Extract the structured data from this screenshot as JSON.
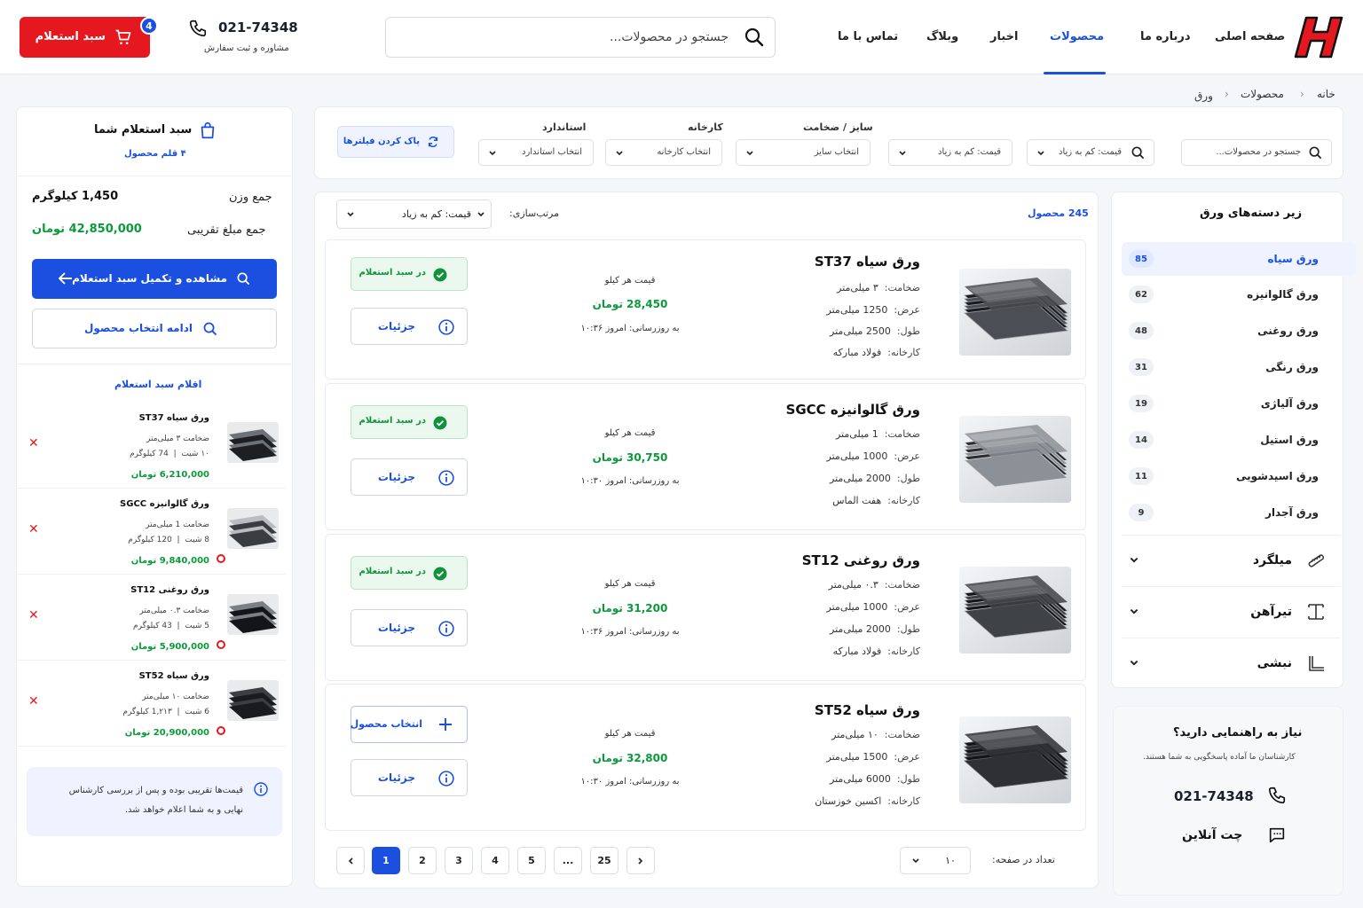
{
  "header": {
    "nav": [
      "صفحه اصلی",
      "درباره ما",
      "محصولات",
      "اخبار",
      "وبلاگ",
      "تماس با ما"
    ],
    "active_nav": "محصولات",
    "search_placeholder": "جستجو در محصولات...",
    "phone": "021-74348",
    "phone_caption": "مشاوره و ثبت سفارش",
    "cart_label": "سبد استعلام",
    "cart_count": "4"
  },
  "breadcrumb": [
    "خانه",
    "محصولات",
    "ورق"
  ],
  "filters": {
    "search_placeholder": "جستجو در محصولات...",
    "price_sort_1": "قیمت: کم به زیاد",
    "price_sort_2": "قیمت: کم به زیاد",
    "size_label": "سایز / ضخامت",
    "size_value": "انتخاب سایز",
    "factory_label": "کارخانه",
    "factory_value": "انتخاب کارخانه",
    "standard_label": "استاندارد",
    "standard_value": "انتخاب استاندارد",
    "clear_label": "پاک کردن فیلترها"
  },
  "listing": {
    "count": "245 محصول",
    "sort_label": "مرتب‌سازی:",
    "sort_value": "قیمت: کم به زیاد",
    "spec_keys": {
      "thickness": "ضخامت:",
      "width": "عرض:",
      "length": "طول:",
      "factory": "کارخانه:"
    },
    "price_label": "قیمت هر کیلو",
    "update_prefix": "به روزرسانی:",
    "in_cart_label": "در سبد استعلام",
    "details_label": "جزئیات",
    "select_label": "انتخاب محصول",
    "products": [
      {
        "title": "ورق سیاه ST37",
        "thickness": "۳ میلی‌متر",
        "width": "1250 میلی‌متر",
        "length": "2500 میلی‌متر",
        "factory": "فولاد مبارکه",
        "price": "28,450 تومان",
        "updated": "امروز ۱۰:۳۶",
        "in_cart": true
      },
      {
        "title": "ورق گالوانیزه SGCC",
        "thickness": "1 میلی‌متر",
        "width": "1000 میلی‌متر",
        "length": "2000 میلی‌متر",
        "factory": "هفت الماس",
        "price": "30,750 تومان",
        "updated": "امروز ۱۰:۳۰",
        "in_cart": true
      },
      {
        "title": "ورق روغنی ST12",
        "thickness": "۰.۳ میلی‌متر",
        "width": "1000 میلی‌متر",
        "length": "2000 میلی‌متر",
        "factory": "فولاد مبارکه",
        "price": "31,200 تومان",
        "updated": "امروز ۱۰:۳۶",
        "in_cart": true
      },
      {
        "title": "ورق سیاه ST52",
        "thickness": "۱۰ میلی‌متر",
        "width": "1500 میلی‌متر",
        "length": "6000 میلی‌متر",
        "factory": "اکسین خوزستان",
        "price": "32,800 تومان",
        "updated": "امروز ۱۰:۳۰",
        "in_cart": false
      }
    ],
    "per_page_label": "تعداد در صفحه:",
    "per_page_value": "۱۰",
    "pages": [
      "1",
      "2",
      "3",
      "4",
      "5",
      "...",
      "25"
    ],
    "current_page": "1"
  },
  "sidebar": {
    "title": "زیر دسته‌های ورق",
    "subcategories": [
      {
        "name": "ورق سیاه",
        "count": "85"
      },
      {
        "name": "ورق گالوانیزه",
        "count": "62"
      },
      {
        "name": "ورق روغنی",
        "count": "48"
      },
      {
        "name": "ورق رنگی",
        "count": "31"
      },
      {
        "name": "ورق آلیاژی",
        "count": "19"
      },
      {
        "name": "ورق استیل",
        "count": "14"
      },
      {
        "name": "ورق اسیدشویی",
        "count": "11"
      },
      {
        "name": "ورق آجدار",
        "count": "9"
      }
    ],
    "categories": [
      "میلگرد",
      "تیرآهن",
      "نبشی"
    ],
    "help_title": "نیاز به راهنمایی دارید؟",
    "help_text": "کارشناسان ما آماده پاسخگویی به شما هستند.",
    "help_phone": "021-74348",
    "help_chat": "چت آنلاین"
  },
  "cart": {
    "title": "سبد استعلام شما",
    "items_count": "۴ قلم محصول",
    "weight_label": "جمع وزن",
    "weight_value": "1,450 کیلوگرم",
    "total_label": "جمع مبلغ تقریبی",
    "total_value": "42,850,000 تومان",
    "view_button": "مشاهده و تکمیل سبد استعلام",
    "continue_button": "ادامه انتخاب محصول",
    "items_title": "اقلام سبد استعلام",
    "items": [
      {
        "title": "ورق سیاه ST37",
        "thickness": "ضخامت ۳ میلی‌متر",
        "qty": "۱۰ شیت",
        "weight": "74 کیلوگرم",
        "price": "6,210,000 تومان"
      },
      {
        "title": "ورق گالوانیزه SGCC",
        "thickness": "ضخامت 1 میلی‌متر",
        "qty": "8 شیت",
        "weight": "120 کیلوگرم",
        "price": "9,840,000 تومان"
      },
      {
        "title": "ورق روغنی ST12",
        "thickness": "ضخامت ۰.۳ میلی‌متر",
        "qty": "5 شیت",
        "weight": "43 کیلوگرم",
        "price": "5,900,000 تومان"
      },
      {
        "title": "ورق سیاه ST52",
        "thickness": "ضخامت ۱۰ میلی‌متر",
        "qty": "6 شیت",
        "weight": "1,۲۱۳ کیلوگرم",
        "price": "20,900,000 تومان"
      }
    ],
    "note": "قیمت‌ها تقریبی بوده و پس از بررسی کارشناس نهایی و به شما اعلام خواهد شد."
  },
  "colors": {
    "brand_red": "#e5181f",
    "accent_blue": "#1a4fe0",
    "price_green": "#0a9a3a"
  }
}
